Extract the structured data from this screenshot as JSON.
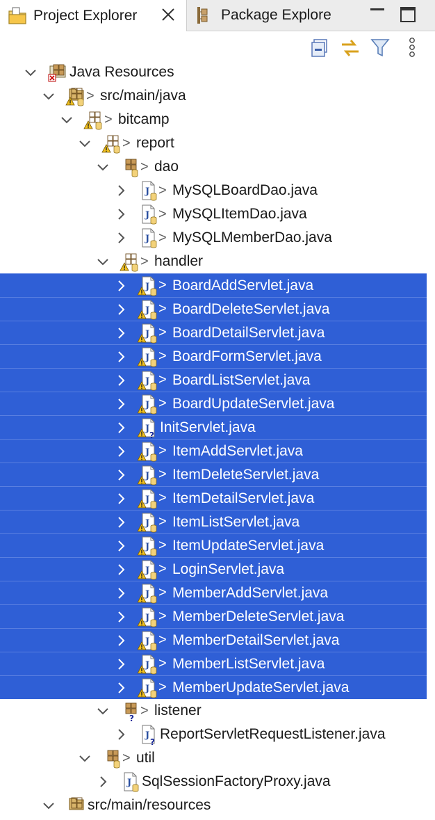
{
  "tabs": {
    "active_label": "Project Explorer",
    "inactive_label": "Package Explore"
  },
  "tree": [
    {
      "label": "Java Resources",
      "depth": 0,
      "expanded": true,
      "icon": "java-resources-icon",
      "arrow": false,
      "selected": false
    },
    {
      "label": "src/main/java",
      "depth": 1,
      "expanded": true,
      "icon": "source-folder-warning-icon",
      "arrow": true,
      "selected": false
    },
    {
      "label": "bitcamp",
      "depth": 2,
      "expanded": true,
      "icon": "package-warning-icon",
      "arrow": true,
      "selected": false
    },
    {
      "label": "report",
      "depth": 3,
      "expanded": true,
      "icon": "package-warning-icon",
      "arrow": true,
      "selected": false
    },
    {
      "label": "dao",
      "depth": 4,
      "expanded": true,
      "icon": "package-icon",
      "arrow": true,
      "selected": false
    },
    {
      "label": "MySQLBoardDao.java",
      "depth": 5,
      "expanded": false,
      "icon": "java-file-icon",
      "arrow": true,
      "selected": false
    },
    {
      "label": "MySQLItemDao.java",
      "depth": 5,
      "expanded": false,
      "icon": "java-file-icon",
      "arrow": true,
      "selected": false
    },
    {
      "label": "MySQLMemberDao.java",
      "depth": 5,
      "expanded": false,
      "icon": "java-file-icon",
      "arrow": true,
      "selected": false
    },
    {
      "label": "handler",
      "depth": 4,
      "expanded": true,
      "icon": "package-warning-icon",
      "arrow": true,
      "selected": false
    },
    {
      "label": "BoardAddServlet.java",
      "depth": 5,
      "expanded": false,
      "icon": "java-file-warning-icon",
      "arrow": true,
      "selected": true
    },
    {
      "label": "BoardDeleteServlet.java",
      "depth": 5,
      "expanded": false,
      "icon": "java-file-warning-icon",
      "arrow": true,
      "selected": true
    },
    {
      "label": "BoardDetailServlet.java",
      "depth": 5,
      "expanded": false,
      "icon": "java-file-warning-icon",
      "arrow": true,
      "selected": true
    },
    {
      "label": "BoardFormServlet.java",
      "depth": 5,
      "expanded": false,
      "icon": "java-file-warning-icon",
      "arrow": true,
      "selected": true
    },
    {
      "label": "BoardListServlet.java",
      "depth": 5,
      "expanded": false,
      "icon": "java-file-warning-icon",
      "arrow": true,
      "selected": true
    },
    {
      "label": "BoardUpdateServlet.java",
      "depth": 5,
      "expanded": false,
      "icon": "java-file-warning-icon",
      "arrow": true,
      "selected": true
    },
    {
      "label": "InitServlet.java",
      "depth": 5,
      "expanded": false,
      "icon": "java-file-unversioned-warning-icon",
      "arrow": false,
      "selected": true
    },
    {
      "label": "ItemAddServlet.java",
      "depth": 5,
      "expanded": false,
      "icon": "java-file-warning-icon",
      "arrow": true,
      "selected": true
    },
    {
      "label": "ItemDeleteServlet.java",
      "depth": 5,
      "expanded": false,
      "icon": "java-file-warning-icon",
      "arrow": true,
      "selected": true
    },
    {
      "label": "ItemDetailServlet.java",
      "depth": 5,
      "expanded": false,
      "icon": "java-file-warning-icon",
      "arrow": true,
      "selected": true
    },
    {
      "label": "ItemListServlet.java",
      "depth": 5,
      "expanded": false,
      "icon": "java-file-warning-icon",
      "arrow": true,
      "selected": true
    },
    {
      "label": "ItemUpdateServlet.java",
      "depth": 5,
      "expanded": false,
      "icon": "java-file-warning-icon",
      "arrow": true,
      "selected": true
    },
    {
      "label": "LoginServlet.java",
      "depth": 5,
      "expanded": false,
      "icon": "java-file-warning-icon",
      "arrow": true,
      "selected": true
    },
    {
      "label": "MemberAddServlet.java",
      "depth": 5,
      "expanded": false,
      "icon": "java-file-warning-icon",
      "arrow": true,
      "selected": true
    },
    {
      "label": "MemberDeleteServlet.java",
      "depth": 5,
      "expanded": false,
      "icon": "java-file-warning-icon",
      "arrow": true,
      "selected": true
    },
    {
      "label": "MemberDetailServlet.java",
      "depth": 5,
      "expanded": false,
      "icon": "java-file-warning-icon",
      "arrow": true,
      "selected": true
    },
    {
      "label": "MemberListServlet.java",
      "depth": 5,
      "expanded": false,
      "icon": "java-file-warning-icon",
      "arrow": true,
      "selected": true
    },
    {
      "label": "MemberUpdateServlet.java",
      "depth": 5,
      "expanded": false,
      "icon": "java-file-warning-icon",
      "arrow": true,
      "selected": true
    },
    {
      "label": "listener",
      "depth": 4,
      "expanded": true,
      "icon": "package-unversioned-icon",
      "arrow": true,
      "selected": false
    },
    {
      "label": "ReportServletRequestListener.java",
      "depth": 5,
      "expanded": false,
      "icon": "java-file-unversioned-icon",
      "arrow": false,
      "selected": false
    },
    {
      "label": "util",
      "depth": 3,
      "expanded": true,
      "icon": "package-icon",
      "arrow": true,
      "selected": false
    },
    {
      "label": "SqlSessionFactoryProxy.java",
      "depth": 4,
      "expanded": false,
      "icon": "java-file-icon",
      "arrow": false,
      "selected": false
    },
    {
      "label": "src/main/resources",
      "depth": 1,
      "expanded": true,
      "icon": "source-folder-icon",
      "arrow": false,
      "selected": false
    }
  ],
  "colors": {
    "selection": "#2f5fd6",
    "warning": "#f0c020",
    "package": "#a07840"
  }
}
